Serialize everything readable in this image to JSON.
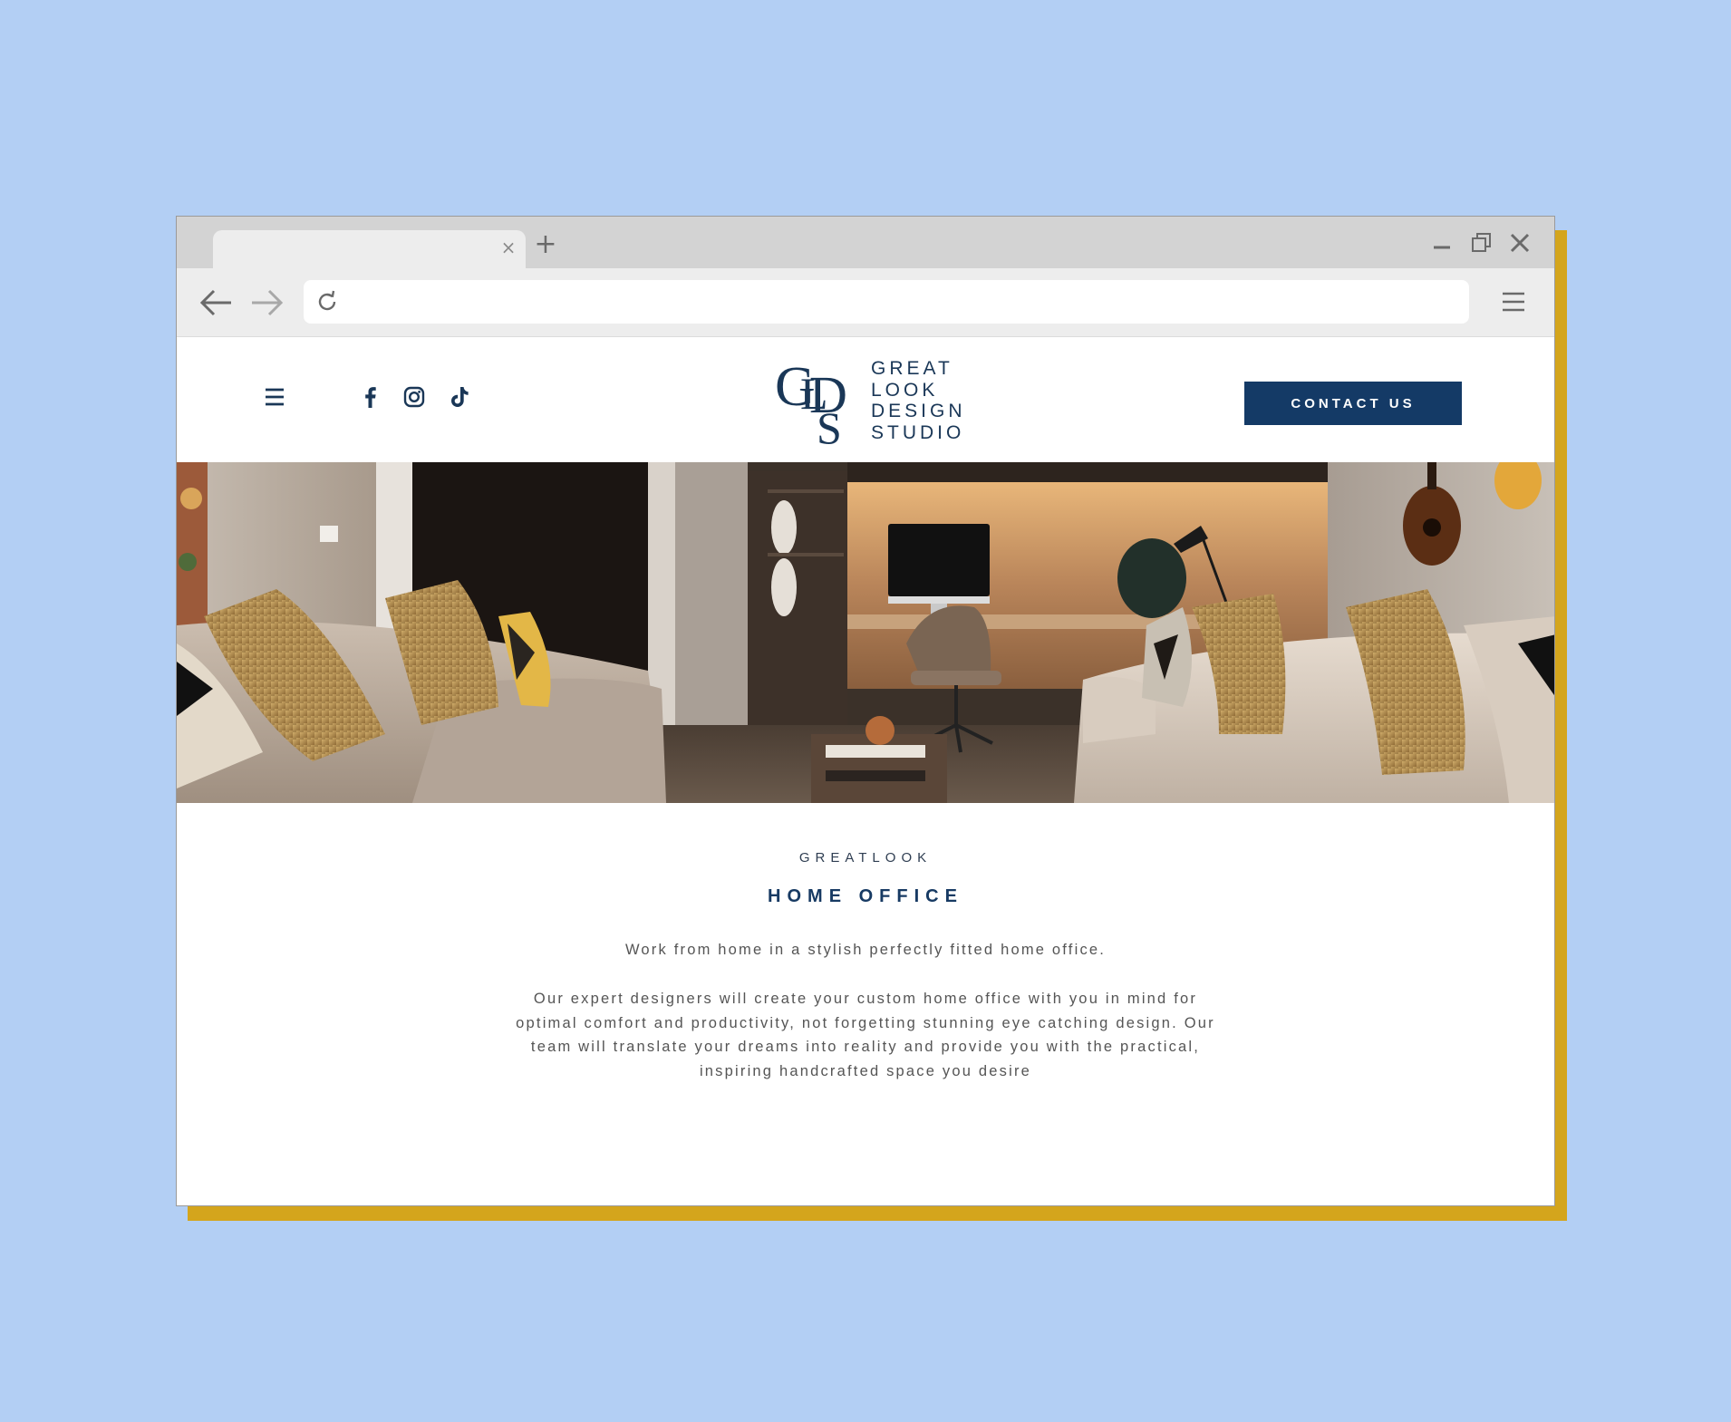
{
  "browser": {
    "tab_title": "",
    "tab_close_icon": "×",
    "new_tab_icon": "+",
    "address": ""
  },
  "header": {
    "logo_monogram": "GLDS",
    "logo_words": [
      "GREAT",
      "LOOK",
      "DESIGN",
      "STUDIO"
    ],
    "social_icons": [
      "facebook-icon",
      "instagram-icon",
      "tiktok-icon"
    ],
    "contact_label": "CONTACT US"
  },
  "hero": {
    "image_subject": "living room with sofas and built-in home office desk"
  },
  "content": {
    "eyebrow": "GREATLOOK",
    "title": "HOME OFFICE",
    "lead": "Work from home in a stylish perfectly fitted home office.",
    "body": "Our expert designers will create your custom home office with you in mind for optimal comfort and productivity, not forgetting stunning eye catching design. Our team will translate your dreams into reality and provide you with the practical, inspiring handcrafted space you desire"
  },
  "colors": {
    "page_background": "#b3cff4",
    "accent_shadow": "#d4a51c",
    "brand_navy": "#143a66"
  }
}
